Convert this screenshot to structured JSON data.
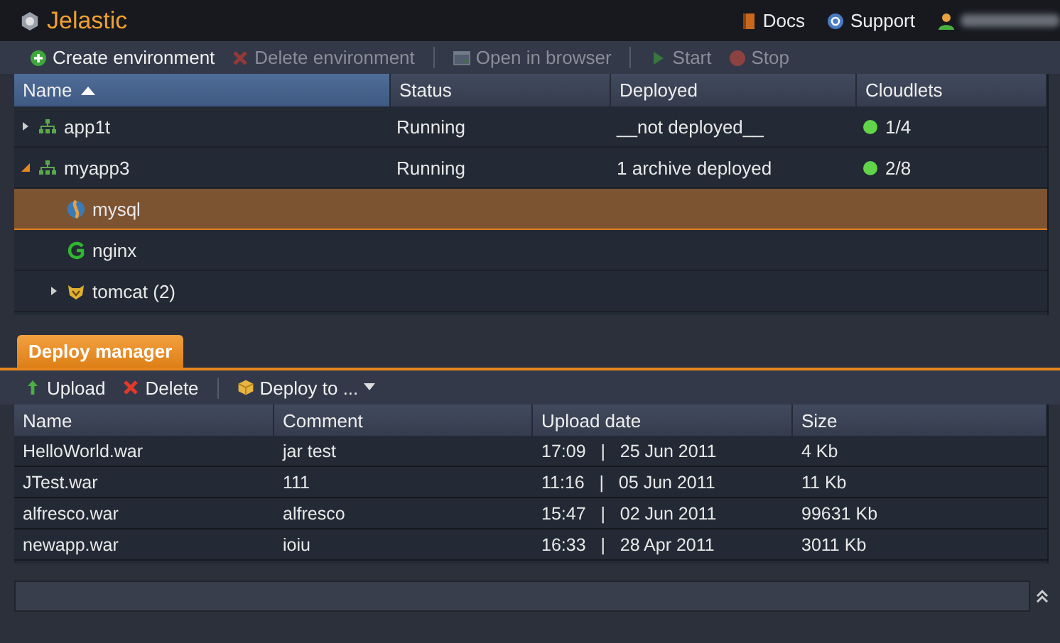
{
  "header": {
    "app_name": "Jelastic",
    "links": [
      {
        "label": "Docs",
        "kind": "docs"
      },
      {
        "label": "Support",
        "kind": "support"
      }
    ]
  },
  "toolbar": [
    {
      "label": "Create environment",
      "kind": "add",
      "disabled": false
    },
    {
      "label": "Delete environment",
      "kind": "delete",
      "disabled": true
    },
    {
      "kind": "separator"
    },
    {
      "label": "Open in browser",
      "kind": "browser",
      "disabled": true
    },
    {
      "kind": "separator"
    },
    {
      "label": "Start",
      "kind": "start",
      "disabled": true
    },
    {
      "label": "Stop",
      "kind": "stop",
      "disabled": true
    }
  ],
  "environments": {
    "columns": [
      {
        "label": "Name",
        "sorted": true
      },
      {
        "label": "Status",
        "sorted": false
      },
      {
        "label": "Deployed",
        "sorted": false
      },
      {
        "label": "Cloudlets",
        "sorted": false
      }
    ],
    "rows": [
      {
        "name": "app1t",
        "kind": "environment",
        "status": "Running",
        "deployed": "__not deployed__",
        "cloudlets": "1/4",
        "expanded": false,
        "selected": false
      },
      {
        "name": "myapp3",
        "kind": "environment",
        "status": "Running",
        "deployed": "1 archive deployed",
        "cloudlets": "2/8",
        "expanded": true,
        "selected": false,
        "children": [
          {
            "name": "mysql",
            "kind": "mysql",
            "selected": true
          },
          {
            "name": "nginx",
            "kind": "nginx",
            "selected": false
          },
          {
            "name": "tomcat (2)",
            "kind": "tomcat",
            "expanded": false,
            "selected": false
          }
        ]
      }
    ]
  },
  "deploy_panel": {
    "tabs": [
      {
        "label": "Deploy manager",
        "selected": true
      }
    ],
    "toolbar": [
      {
        "label": "Upload",
        "kind": "upload"
      },
      {
        "label": "Delete",
        "kind": "delete"
      },
      {
        "kind": "separator"
      },
      {
        "label": "Deploy to ...",
        "kind": "deploy_menu"
      }
    ],
    "columns": [
      "Name",
      "Comment",
      "Upload date",
      "Size"
    ],
    "rows": [
      [
        "HelloWorld.war",
        "jar test",
        "17:09   |   25 Jun 2011",
        "4 Kb"
      ],
      [
        "JTest.war",
        "111",
        "11:16   |   05 Jun 2011",
        "11 Kb"
      ],
      [
        "alfresco.war",
        "alfresco",
        "15:47   |   02 Jun 2011",
        "99631 Kb"
      ],
      [
        "newapp.war",
        "ioiu",
        "16:33   |   28 Apr 2011",
        "3011 Kb"
      ]
    ]
  }
}
